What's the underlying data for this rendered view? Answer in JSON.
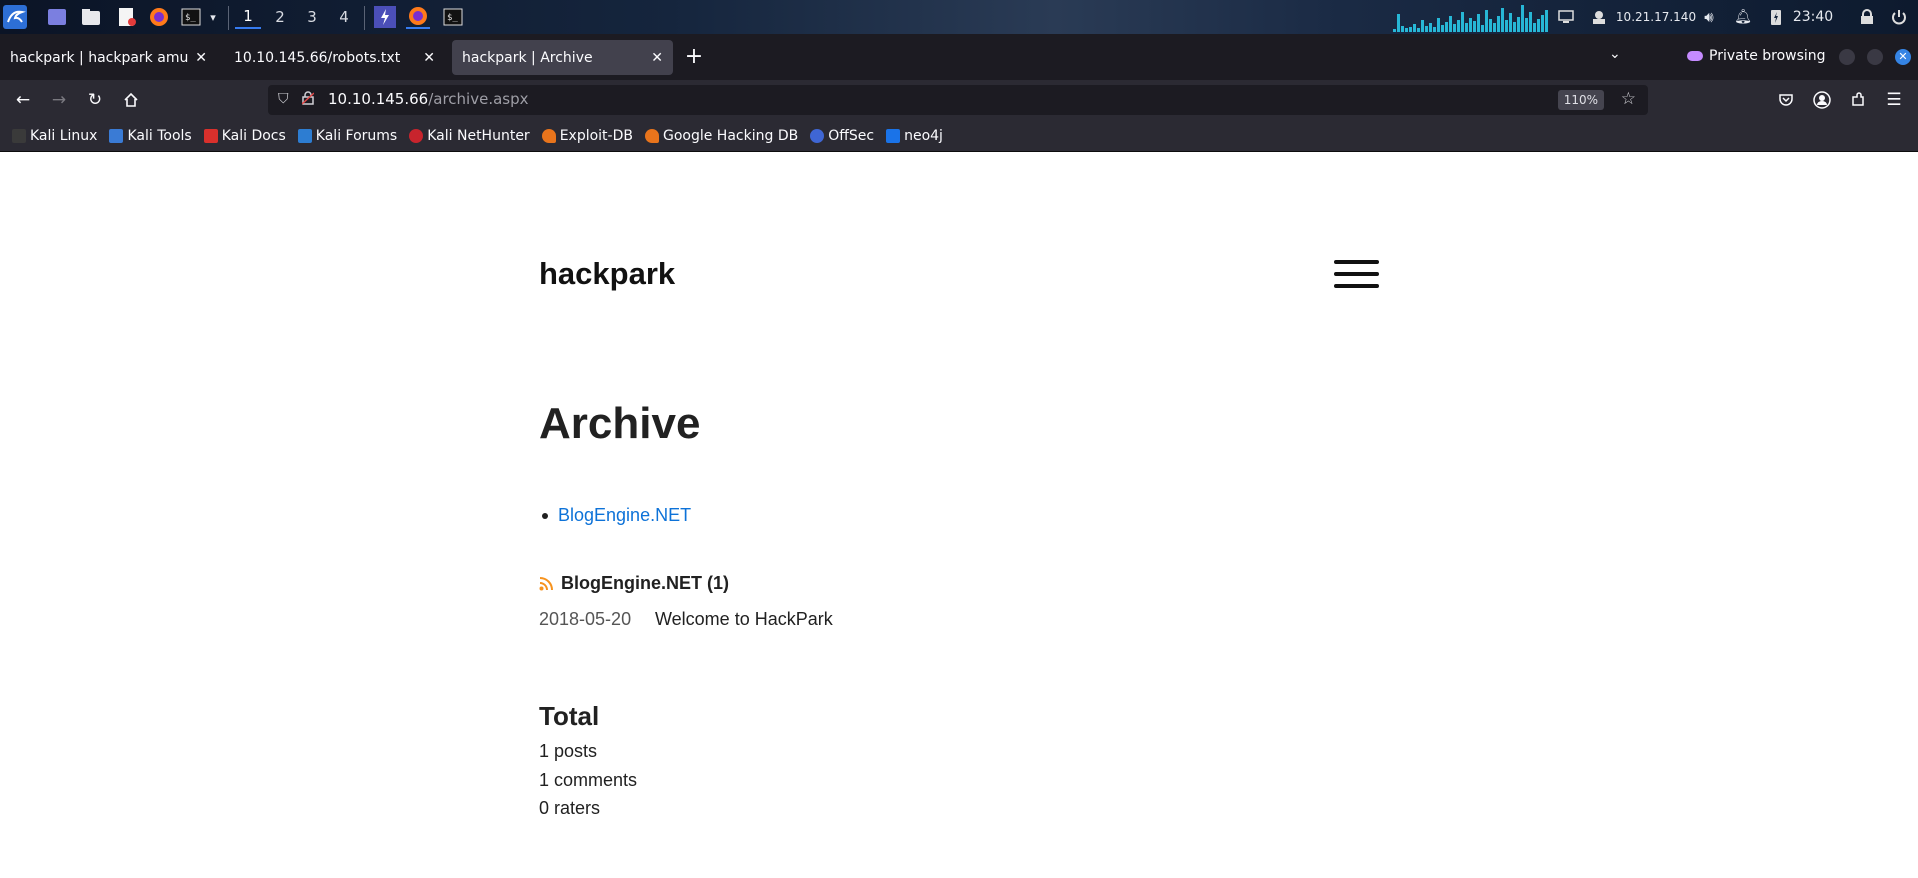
{
  "panel": {
    "workspaces": [
      "1",
      "2",
      "3",
      "4"
    ],
    "active_workspace": "1",
    "ip": "10.21.17.140",
    "clock": "23:40"
  },
  "tabs": [
    {
      "title": "hackpark | hackpark amusem",
      "active": false
    },
    {
      "title": "10.10.145.66/robots.txt",
      "active": false
    },
    {
      "title": "hackpark | Archive",
      "active": true
    }
  ],
  "private_label": "Private browsing",
  "urlbar": {
    "host": "10.10.145.66",
    "path": "/archive.aspx",
    "zoom": "110%"
  },
  "bookmarks": [
    {
      "label": "Kali Linux",
      "icon": "kali-dragon-icon",
      "color": "#3a3a3a"
    },
    {
      "label": "Kali Tools",
      "icon": "kali-tools-icon",
      "color": "#3a7bd5"
    },
    {
      "label": "Kali Docs",
      "icon": "kali-docs-icon",
      "color": "#d9302c"
    },
    {
      "label": "Kali Forums",
      "icon": "kali-forums-icon",
      "color": "#2d7dd2"
    },
    {
      "label": "Kali NetHunter",
      "icon": "nethunter-icon",
      "color": "#c8242d"
    },
    {
      "label": "Exploit-DB",
      "icon": "exploitdb-icon",
      "color": "#e8741c"
    },
    {
      "label": "Google Hacking DB",
      "icon": "ghdb-icon",
      "color": "#e8741c"
    },
    {
      "label": "OffSec",
      "icon": "offsec-icon",
      "color": "#3f66d4"
    },
    {
      "label": "neo4j",
      "icon": "neo4j-icon",
      "color": "#1a73e8"
    }
  ],
  "page": {
    "site_title": "hackpark",
    "title": "Archive",
    "categories": [
      "BlogEngine.NET"
    ],
    "category_heading": "BlogEngine.NET (1)",
    "posts": [
      {
        "date": "2018-05-20",
        "title": "Welcome to HackPark"
      }
    ],
    "total_heading": "Total",
    "totals": [
      "1 posts",
      "1 comments",
      "0 raters"
    ]
  }
}
